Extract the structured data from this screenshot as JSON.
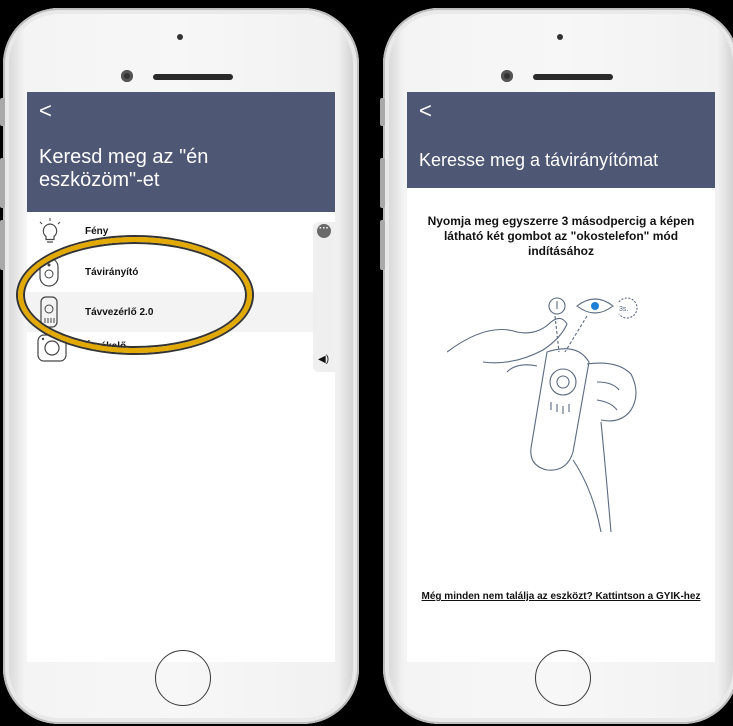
{
  "left_screen": {
    "back_glyph": "<",
    "title": "Keresd meg az \"én eszközöm\"-et",
    "items": [
      {
        "label": "Fény",
        "icon": "bulb-icon"
      },
      {
        "label": "Távirányító",
        "icon": "remote-icon"
      },
      {
        "label": "Távvezérlő 2.0",
        "icon": "remote-2-icon"
      },
      {
        "label": "Érzékelő",
        "icon": "sensor-icon"
      }
    ],
    "menu_glyph": "···",
    "volume_glyph": "◀)",
    "highlight_color": "#e2a900"
  },
  "right_screen": {
    "back_glyph": "<",
    "title": "Keresse meg a távirányítómat",
    "instruction": "Nyomja meg egyszerre 3 másodpercig a képen látható két gombot az \"okostelefon\" mód indításához",
    "timer_label": "3s.",
    "faq_link": "Még minden nem találja az eszközt? Kattintson a GYIK-hez"
  },
  "colors": {
    "header": "#4e5774",
    "background": "#000000"
  }
}
